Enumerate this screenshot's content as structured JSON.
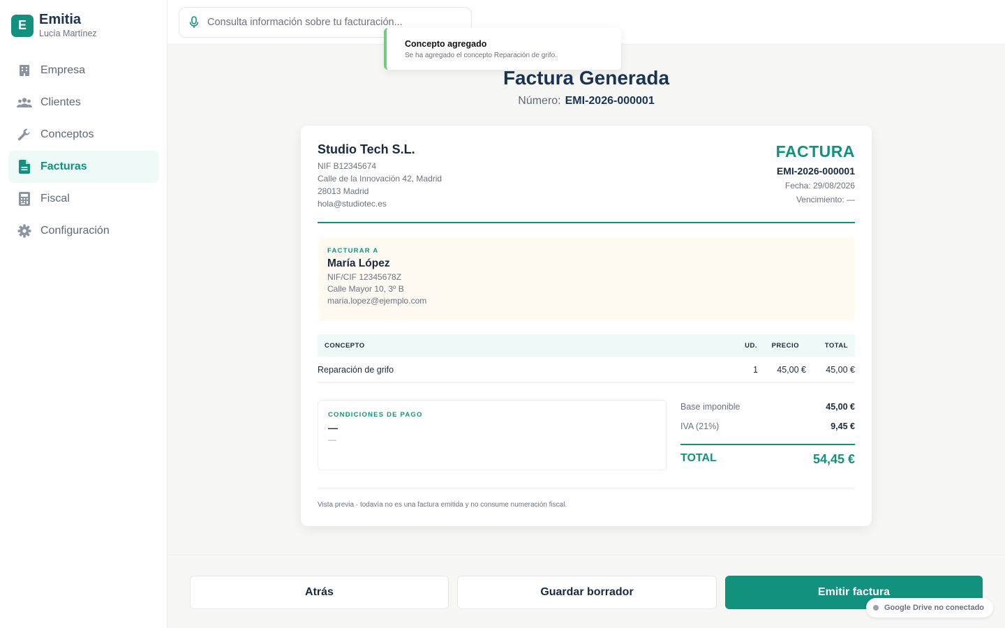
{
  "app": {
    "logo_letter": "E",
    "name": "Emitia",
    "user": "Lucía Martínez"
  },
  "sidebar": {
    "items": [
      {
        "label": "Empresa",
        "icon": "building-icon",
        "active": false
      },
      {
        "label": "Clientes",
        "icon": "users-icon",
        "active": false
      },
      {
        "label": "Conceptos",
        "icon": "wrench-icon",
        "active": false
      },
      {
        "label": "Facturas",
        "icon": "document-icon",
        "active": true
      },
      {
        "label": "Fiscal",
        "icon": "calculator-icon",
        "active": false
      },
      {
        "label": "Configuración",
        "icon": "gear-icon",
        "active": false
      }
    ]
  },
  "search": {
    "placeholder": "Consulta información sobre tu facturación...",
    "value": ""
  },
  "toast": {
    "title": "Concepto agregado",
    "message": "Se ha agregado el concepto Reparación de grifo."
  },
  "header": {
    "title": "Factura Generada",
    "number_label": "Número:",
    "number": "EMI-2026-000001"
  },
  "invoice": {
    "company": {
      "name": "Studio Tech S.L.",
      "nif": "NIF B12345674",
      "address": "Calle de la Innovación 42, Madrid",
      "city": "28013 Madrid",
      "email": "hola@studiotec.es"
    },
    "doc_label": "FACTURA",
    "number": "EMI-2026-000001",
    "date": "Fecha: 29/08/2026",
    "due": "Vencimiento: —",
    "bill_to": {
      "label": "FACTURAR A",
      "name": "María López",
      "nif": "NIF/CIF 12345678Z",
      "address": "Calle Mayor 10, 3º B",
      "email": "maria.lopez@ejemplo.com"
    },
    "table": {
      "headers": {
        "concept": "CONCEPTO",
        "units": "UD.",
        "price": "PRECIO",
        "total": "TOTAL"
      },
      "rows": [
        {
          "concept": "Reparación de grifo",
          "units": "1",
          "price": "45,00 €",
          "total": "45,00 €"
        }
      ]
    },
    "conditions": {
      "label": "CONDICIONES DE PAGO",
      "main": "—",
      "sub": "—"
    },
    "totals": {
      "base_label": "Base imponible",
      "base_value": "45,00 €",
      "iva_label": "IVA (21%)",
      "iva_value": "9,45 €",
      "total_label": "TOTAL",
      "total_value": "54,45 €"
    },
    "footer_note": "Vista previa · todavía no es una factura emitida y no consume numeración fiscal."
  },
  "actions": {
    "back": "Atrás",
    "draft": "Guardar borrador",
    "emit": "Emitir factura"
  },
  "drive_status": "Google Drive no conectado",
  "colors": {
    "accent": "#12917f",
    "navy": "#1a3352",
    "toast_bar": "#6ccf7f"
  }
}
